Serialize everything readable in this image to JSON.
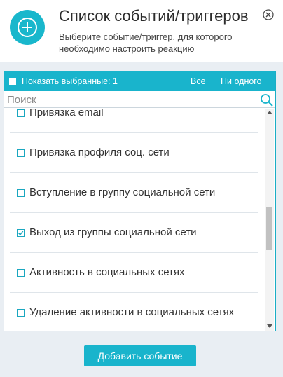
{
  "header": {
    "title": "Список событий/триггеров",
    "subtitle": "Выберите событие/триггер, для которого необходимо настроить реакцию",
    "icon": "plus-circle-icon",
    "close_icon": "close-icon",
    "accent": "#19b4cc"
  },
  "toolbar": {
    "show_selected_label": "Показать выбранные: 1",
    "all_label": "Все",
    "none_label": "Ни одного"
  },
  "search": {
    "placeholder": "Поиск",
    "icon": "search-icon"
  },
  "events": [
    {
      "label": "Привязка email",
      "checked": false
    },
    {
      "label": "Привязка профиля соц. сети",
      "checked": false
    },
    {
      "label": "Вступление в группу социальной сети",
      "checked": false
    },
    {
      "label": "Выход из группы социальной сети",
      "checked": true
    },
    {
      "label": "Активность в социальных сетях",
      "checked": false
    },
    {
      "label": "Удаление активности в социальных сетях",
      "checked": false
    }
  ],
  "add_button_label": "Добавить событие"
}
